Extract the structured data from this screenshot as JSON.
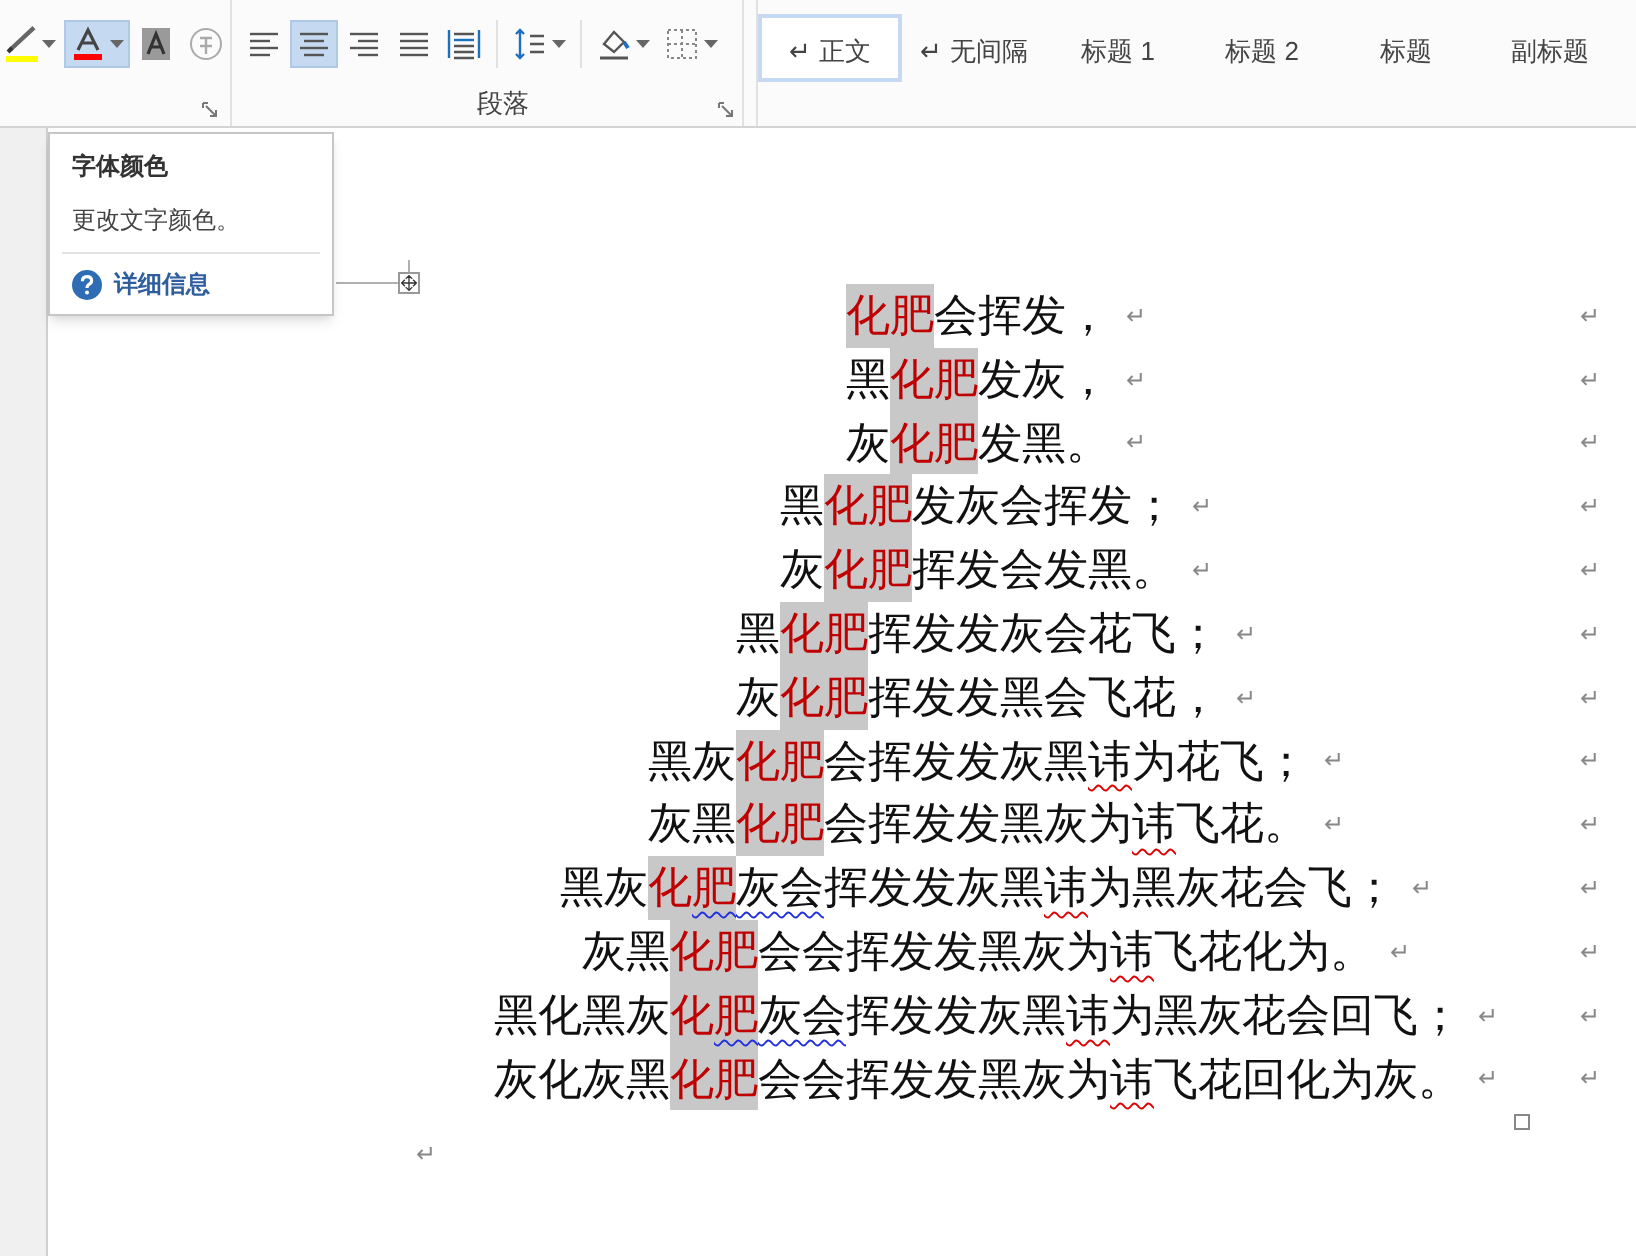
{
  "ribbon": {
    "font_tools": [
      {
        "kind": "highlighter",
        "selected": false,
        "dropdown": true
      },
      {
        "kind": "fontcolor",
        "selected": true,
        "dropdown": true
      },
      {
        "kind": "shading",
        "selected": false,
        "dropdown": false
      },
      {
        "kind": "enclosed",
        "selected": false,
        "dropdown": false
      }
    ],
    "paragraph_tools": [
      {
        "kind": "alignleft",
        "selected": false,
        "dropdown": false
      },
      {
        "kind": "aligncenter",
        "selected": true,
        "dropdown": false
      },
      {
        "kind": "alignright",
        "selected": false,
        "dropdown": false
      },
      {
        "kind": "justify",
        "selected": false,
        "dropdown": false
      },
      {
        "kind": "distributed",
        "selected": false,
        "dropdown": false
      },
      {
        "kind": "linespacing",
        "selected": false,
        "dropdown": true
      },
      {
        "kind": "fill",
        "selected": false,
        "dropdown": true
      },
      {
        "kind": "borders",
        "selected": false,
        "dropdown": true
      }
    ],
    "paragraph_label": "段落",
    "styles": [
      {
        "label": "↵ 正文",
        "selected": true
      },
      {
        "label": "↵ 无间隔",
        "selected": false
      },
      {
        "label": "标题 1",
        "selected": false
      },
      {
        "label": "标题 2",
        "selected": false
      },
      {
        "label": "标题",
        "selected": false
      },
      {
        "label": "副标题",
        "selected": false
      }
    ]
  },
  "tooltip": {
    "title": "字体颜色",
    "description": "更改文字颜色。",
    "link": "详细信息"
  },
  "lines": [
    {
      "segments": [
        {
          "text": "化肥",
          "highlight": true,
          "spelling": false,
          "grammar": false
        },
        {
          "text": "会挥发，",
          "highlight": false,
          "spelling": false,
          "grammar": false
        }
      ],
      "mark": "↵",
      "cell_mark": "↵"
    },
    {
      "segments": [
        {
          "text": "黑",
          "highlight": false,
          "spelling": false,
          "grammar": false
        },
        {
          "text": "化肥",
          "highlight": true,
          "spelling": false,
          "grammar": false
        },
        {
          "text": "发灰，",
          "highlight": false,
          "spelling": false,
          "grammar": false
        }
      ],
      "mark": "↵",
      "cell_mark": "↵"
    },
    {
      "segments": [
        {
          "text": "灰",
          "highlight": false,
          "spelling": false,
          "grammar": false
        },
        {
          "text": "化肥",
          "highlight": true,
          "spelling": false,
          "grammar": false
        },
        {
          "text": "发黑。",
          "highlight": false,
          "spelling": false,
          "grammar": false
        }
      ],
      "mark": "↵",
      "cell_mark": "↵"
    },
    {
      "segments": [
        {
          "text": "黑",
          "highlight": false,
          "spelling": false,
          "grammar": false
        },
        {
          "text": "化肥",
          "highlight": true,
          "spelling": false,
          "grammar": false
        },
        {
          "text": "发灰会挥发；",
          "highlight": false,
          "spelling": false,
          "grammar": false
        }
      ],
      "mark": "↵",
      "cell_mark": "↵"
    },
    {
      "segments": [
        {
          "text": "灰",
          "highlight": false,
          "spelling": false,
          "grammar": false
        },
        {
          "text": "化肥",
          "highlight": true,
          "spelling": false,
          "grammar": false
        },
        {
          "text": "挥发会发黑。",
          "highlight": false,
          "spelling": false,
          "grammar": false
        }
      ],
      "mark": "↵",
      "cell_mark": "↵"
    },
    {
      "segments": [
        {
          "text": "黑",
          "highlight": false,
          "spelling": false,
          "grammar": false
        },
        {
          "text": "化肥",
          "highlight": true,
          "spelling": false,
          "grammar": false
        },
        {
          "text": "挥发发灰会花飞；",
          "highlight": false,
          "spelling": false,
          "grammar": false
        }
      ],
      "mark": "↵",
      "cell_mark": "↵"
    },
    {
      "segments": [
        {
          "text": "灰",
          "highlight": false,
          "spelling": false,
          "grammar": false
        },
        {
          "text": "化肥",
          "highlight": true,
          "spelling": false,
          "grammar": false
        },
        {
          "text": "挥发发黑会飞花，",
          "highlight": false,
          "spelling": false,
          "grammar": false
        }
      ],
      "mark": "↵",
      "cell_mark": "↵"
    },
    {
      "segments": [
        {
          "text": "黑灰",
          "highlight": false,
          "spelling": false,
          "grammar": false
        },
        {
          "text": "化肥",
          "highlight": true,
          "spelling": false,
          "grammar": false
        },
        {
          "text": "会挥发发灰黑",
          "highlight": false,
          "spelling": false,
          "grammar": false
        },
        {
          "text": "讳",
          "highlight": false,
          "spelling": true,
          "grammar": false
        },
        {
          "text": "为花飞；",
          "highlight": false,
          "spelling": false,
          "grammar": false
        }
      ],
      "mark": "↵",
      "cell_mark": "↵"
    },
    {
      "segments": [
        {
          "text": "灰黑",
          "highlight": false,
          "spelling": false,
          "grammar": false
        },
        {
          "text": "化肥",
          "highlight": true,
          "spelling": false,
          "grammar": false
        },
        {
          "text": "会挥发发黑灰为",
          "highlight": false,
          "spelling": false,
          "grammar": false
        },
        {
          "text": "讳",
          "highlight": false,
          "spelling": true,
          "grammar": false
        },
        {
          "text": "飞花。",
          "highlight": false,
          "spelling": false,
          "grammar": false
        }
      ],
      "mark": "↵",
      "cell_mark": "↵"
    },
    {
      "segments": [
        {
          "text": "黑灰",
          "highlight": false,
          "spelling": false,
          "grammar": false
        },
        {
          "text": "化",
          "highlight": true,
          "spelling": false,
          "grammar": false
        },
        {
          "text": "肥",
          "highlight": true,
          "spelling": false,
          "grammar": true
        },
        {
          "text": "灰会",
          "highlight": false,
          "spelling": false,
          "grammar": true
        },
        {
          "text": "挥发发灰黑",
          "highlight": false,
          "spelling": false,
          "grammar": false
        },
        {
          "text": "讳",
          "highlight": false,
          "spelling": true,
          "grammar": false
        },
        {
          "text": "为黑灰花会飞；",
          "highlight": false,
          "spelling": false,
          "grammar": false
        }
      ],
      "mark": "↵",
      "cell_mark": "↵"
    },
    {
      "segments": [
        {
          "text": "灰黑",
          "highlight": false,
          "spelling": false,
          "grammar": false
        },
        {
          "text": "化肥",
          "highlight": true,
          "spelling": false,
          "grammar": false
        },
        {
          "text": "会会挥发发黑灰为",
          "highlight": false,
          "spelling": false,
          "grammar": false
        },
        {
          "text": "讳",
          "highlight": false,
          "spelling": true,
          "grammar": false
        },
        {
          "text": "飞花化为。",
          "highlight": false,
          "spelling": false,
          "grammar": false
        }
      ],
      "mark": "↵",
      "cell_mark": "↵"
    },
    {
      "segments": [
        {
          "text": "黑化黑灰",
          "highlight": false,
          "spelling": false,
          "grammar": false
        },
        {
          "text": "化",
          "highlight": true,
          "spelling": false,
          "grammar": false
        },
        {
          "text": "肥",
          "highlight": true,
          "spelling": false,
          "grammar": true
        },
        {
          "text": "灰会",
          "highlight": false,
          "spelling": false,
          "grammar": true
        },
        {
          "text": "挥发发灰黑",
          "highlight": false,
          "spelling": false,
          "grammar": false
        },
        {
          "text": "讳",
          "highlight": false,
          "spelling": true,
          "grammar": false
        },
        {
          "text": "为黑灰花会回飞；",
          "highlight": false,
          "spelling": false,
          "grammar": false
        }
      ],
      "mark": "↵",
      "cell_mark": "↵"
    },
    {
      "segments": [
        {
          "text": "灰化灰黑",
          "highlight": false,
          "spelling": false,
          "grammar": false
        },
        {
          "text": "化肥",
          "highlight": true,
          "spelling": false,
          "grammar": false
        },
        {
          "text": "会会挥发发黑灰为",
          "highlight": false,
          "spelling": false,
          "grammar": false
        },
        {
          "text": "讳",
          "highlight": false,
          "spelling": true,
          "grammar": false
        },
        {
          "text": "飞花回化为灰。",
          "highlight": false,
          "spelling": false,
          "grammar": false
        }
      ],
      "mark": "↵",
      "cell_mark": "↵"
    }
  ],
  "final_mark": "↵"
}
